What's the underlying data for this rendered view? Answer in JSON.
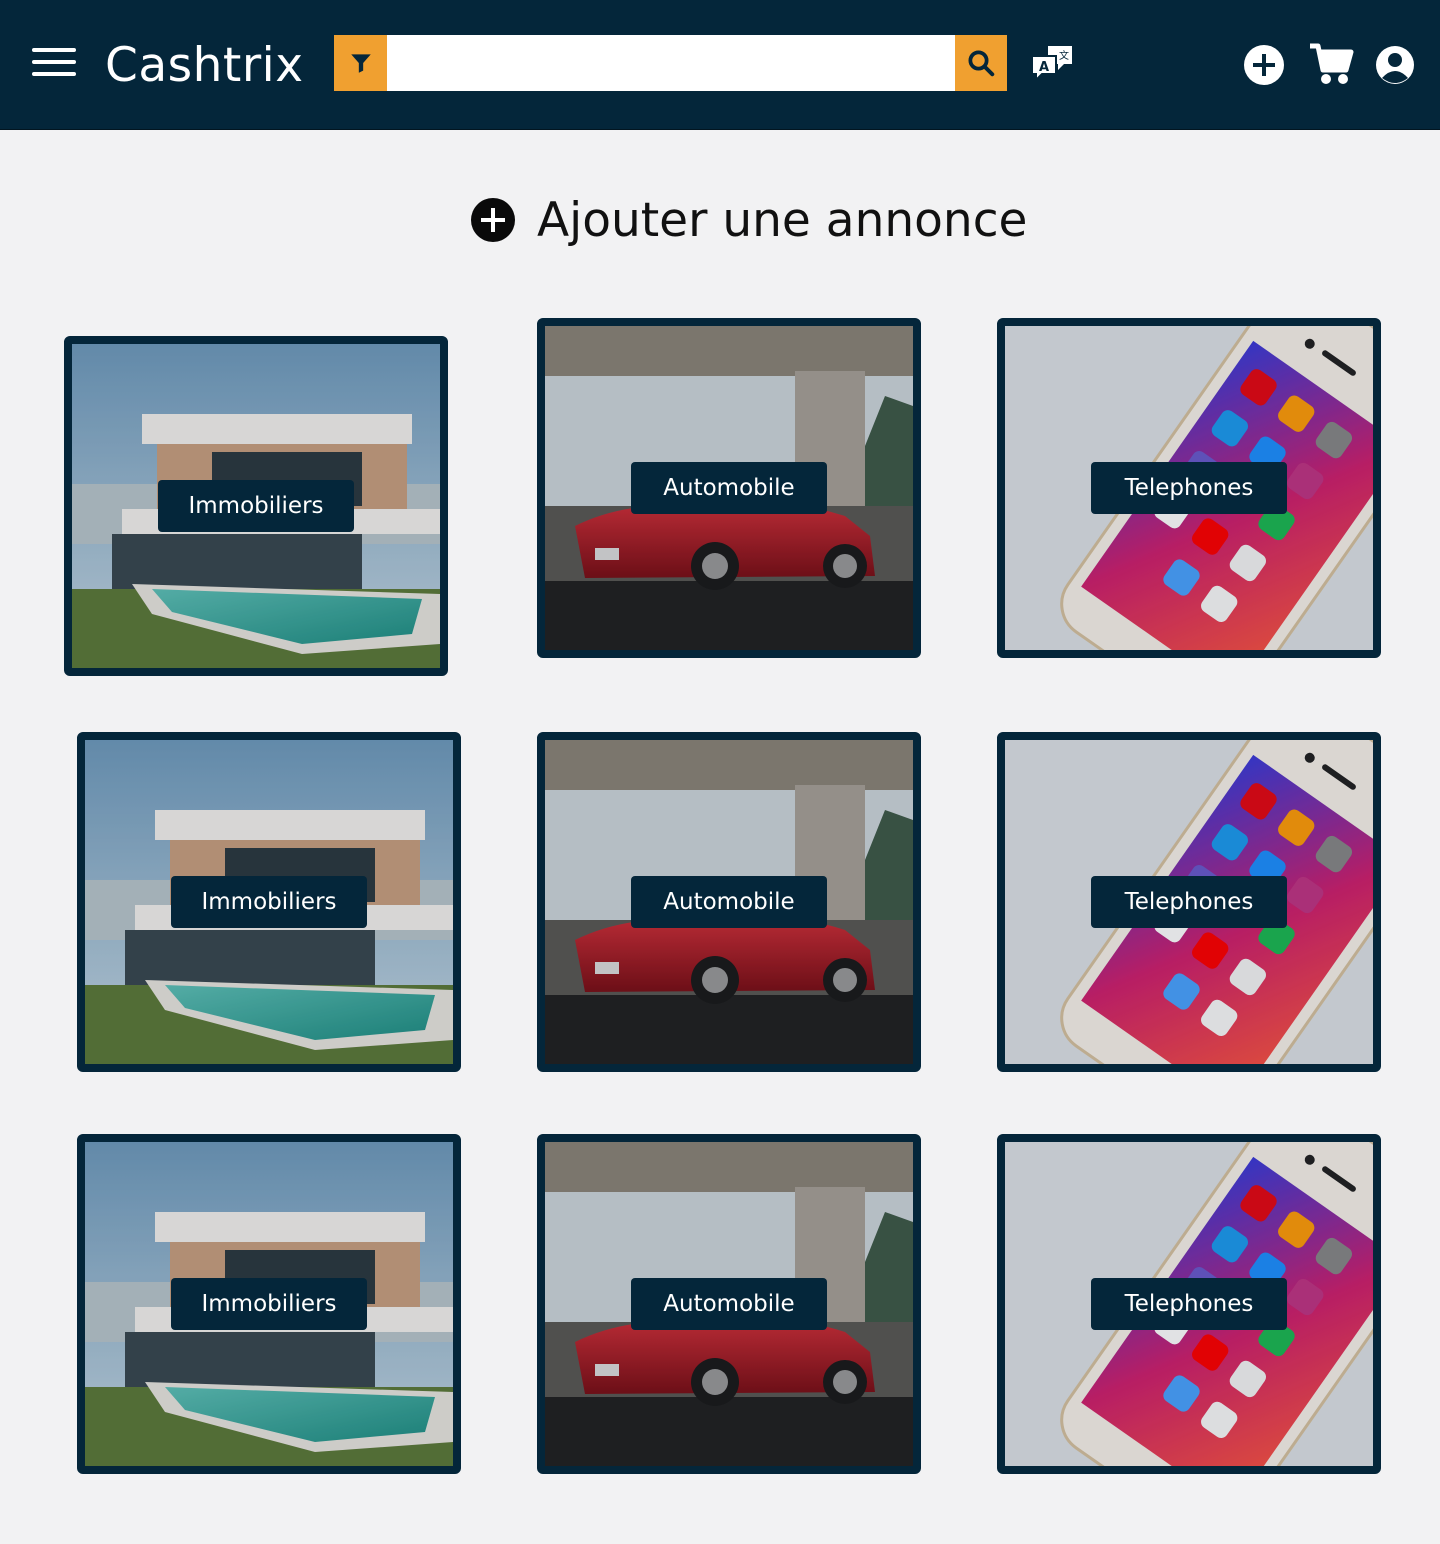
{
  "header": {
    "brand": "Cashtrix",
    "search": {
      "placeholder": "",
      "value": ""
    },
    "icons": {
      "menu": "hamburger-menu-icon",
      "filter": "filter-funnel-icon",
      "search": "magnifier-icon",
      "translate": "translate-icon",
      "add": "plus-circle-icon",
      "cart": "cart-icon",
      "user": "user-circle-icon"
    }
  },
  "main": {
    "add_listing_label": "Ajouter une annonce"
  },
  "categories": [
    {
      "label": "Immobiliers",
      "image": "house-with-pool-photo"
    },
    {
      "label": "Automobile",
      "image": "red-sports-car-photo"
    },
    {
      "label": "Telephones",
      "image": "smartphone-photo"
    },
    {
      "label": "Immobiliers",
      "image": "house-with-pool-photo"
    },
    {
      "label": "Automobile",
      "image": "red-sports-car-photo"
    },
    {
      "label": "Telephones",
      "image": "smartphone-photo"
    },
    {
      "label": "Immobiliers",
      "image": "house-with-pool-photo"
    },
    {
      "label": "Automobile",
      "image": "red-sports-car-photo"
    },
    {
      "label": "Telephones",
      "image": "smartphone-photo"
    }
  ],
  "colors": {
    "navbar": "#04263a",
    "accent": "#f0a030",
    "background": "#f2f2f3"
  }
}
